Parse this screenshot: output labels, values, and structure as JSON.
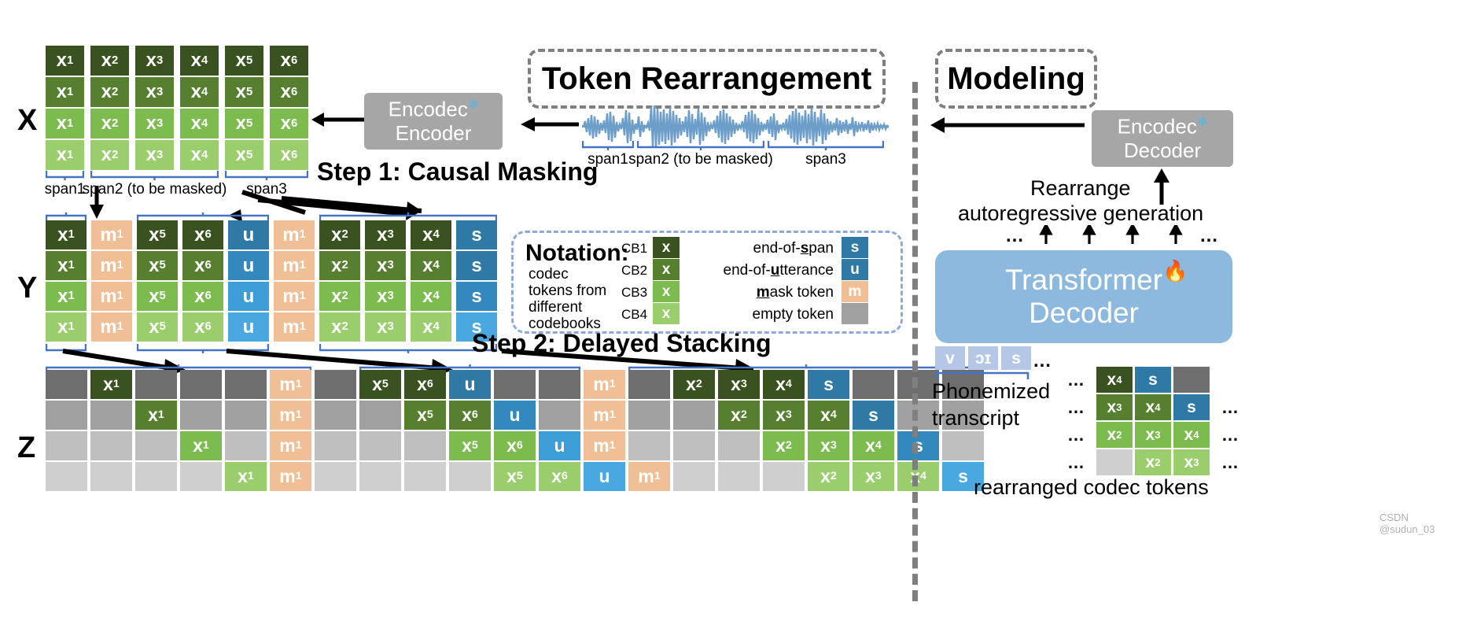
{
  "colors": {
    "cb1": "#3a5220",
    "cb2": "#56802f",
    "cb3": "#7cbb4e",
    "cb4": "#9ace6c",
    "mask": "#f0bf96",
    "eos_span": "#2e79a6",
    "eou": "#3d9dd6",
    "eos_span2": "#3389bd",
    "eou2": "#4aa8e0",
    "empty_dark": "#6e6e6e",
    "empty_mid": "#a0a0a0",
    "empty_light": "#bfbfbf",
    "bracket": "#4472c4",
    "wave": "#6d9ec9",
    "phoneme": "#b4c7e7",
    "transformer": "#8cb9dd",
    "gray_block": "#a6a6a6",
    "dash_gray": "#7f7f7f",
    "dash_blue": "#8da9db"
  },
  "headers": {
    "token_rearrangement": "Token Rearrangement",
    "modeling": "Modeling",
    "step1": "Step 1: Causal Masking",
    "step2": "Step 2: Delayed Stacking"
  },
  "row_labels": {
    "x": "X",
    "y": "Y",
    "z": "Z"
  },
  "encodec": {
    "encoder_line1": "Encodec",
    "encoder_line2": "Encoder",
    "decoder_line1": "Encodec",
    "decoder_line2": "Decoder",
    "snowflake": "❄"
  },
  "spans": {
    "span1": "span1",
    "span2": "span2 (to be masked)",
    "span3": "span3"
  },
  "matrix_x": {
    "columns": [
      "x₁",
      "x₂",
      "x₃",
      "x₄",
      "x₅",
      "x₆"
    ],
    "base": [
      "x",
      "x",
      "x",
      "x",
      "x",
      "x"
    ],
    "subs": [
      "1",
      "2",
      "3",
      "4",
      "5",
      "6"
    ],
    "rows": 4,
    "col_groups": [
      {
        "label": "span1",
        "start": 0,
        "count": 1
      },
      {
        "label": "span2 (to be masked)",
        "start": 1,
        "count": 3
      },
      {
        "label": "span3",
        "start": 4,
        "count": 2
      }
    ]
  },
  "matrix_y": {
    "cells": [
      {
        "base": "x",
        "sub": "1",
        "kind": "codec"
      },
      {
        "base": "m",
        "sub": "1",
        "kind": "mask"
      },
      {
        "base": "x",
        "sub": "5",
        "kind": "codec"
      },
      {
        "base": "x",
        "sub": "6",
        "kind": "codec"
      },
      {
        "base": "u",
        "sub": "",
        "kind": "eou"
      },
      {
        "base": "m",
        "sub": "1",
        "kind": "mask"
      },
      {
        "base": "x",
        "sub": "2",
        "kind": "codec"
      },
      {
        "base": "x",
        "sub": "3",
        "kind": "codec"
      },
      {
        "base": "x",
        "sub": "4",
        "kind": "codec"
      },
      {
        "base": "s",
        "sub": "",
        "kind": "eos"
      }
    ],
    "rows": 4,
    "brackets": [
      {
        "start": 0,
        "count": 1
      },
      {
        "start": 2,
        "count": 3
      },
      {
        "start": 6,
        "count": 4
      }
    ]
  },
  "matrix_z": {
    "rows": 4,
    "cols": 17,
    "grid": [
      [
        {
          "kind": "empty"
        },
        {
          "base": "x",
          "sub": "1",
          "kind": "codec"
        },
        {
          "kind": "empty"
        },
        {
          "kind": "empty"
        },
        {
          "kind": "empty"
        },
        {
          "base": "m",
          "sub": "1",
          "kind": "mask"
        },
        {
          "kind": "empty"
        },
        {
          "base": "x",
          "sub": "5",
          "kind": "codec"
        },
        {
          "base": "x",
          "sub": "6",
          "kind": "codec"
        },
        {
          "base": "u",
          "sub": "",
          "kind": "eou"
        },
        {
          "kind": "empty"
        },
        {
          "kind": "empty"
        },
        {
          "base": "m",
          "sub": "1",
          "kind": "mask"
        },
        {
          "kind": "empty"
        },
        {
          "base": "x",
          "sub": "2",
          "kind": "codec"
        },
        {
          "base": "x",
          "sub": "3",
          "kind": "codec"
        },
        {
          "base": "x",
          "sub": "4",
          "kind": "codec"
        },
        {
          "base": "s",
          "sub": "",
          "kind": "eos"
        },
        {
          "kind": "empty"
        },
        {
          "kind": "empty"
        },
        {
          "kind": "empty"
        }
      ],
      [
        {
          "kind": "empty"
        },
        {
          "kind": "empty"
        },
        {
          "base": "x",
          "sub": "1",
          "kind": "codec"
        },
        {
          "kind": "empty"
        },
        {
          "kind": "empty"
        },
        {
          "base": "m",
          "sub": "1",
          "kind": "mask"
        },
        {
          "kind": "empty"
        },
        {
          "kind": "empty"
        },
        {
          "base": "x",
          "sub": "5",
          "kind": "codec"
        },
        {
          "base": "x",
          "sub": "6",
          "kind": "codec"
        },
        {
          "base": "u",
          "sub": "",
          "kind": "eou"
        },
        {
          "kind": "empty"
        },
        {
          "base": "m",
          "sub": "1",
          "kind": "mask"
        },
        {
          "kind": "empty"
        },
        {
          "kind": "empty"
        },
        {
          "base": "x",
          "sub": "2",
          "kind": "codec"
        },
        {
          "base": "x",
          "sub": "3",
          "kind": "codec"
        },
        {
          "base": "x",
          "sub": "4",
          "kind": "codec"
        },
        {
          "base": "s",
          "sub": "",
          "kind": "eos"
        },
        {
          "kind": "empty"
        },
        {
          "kind": "empty"
        }
      ],
      [
        {
          "kind": "empty"
        },
        {
          "kind": "empty"
        },
        {
          "kind": "empty"
        },
        {
          "base": "x",
          "sub": "1",
          "kind": "codec"
        },
        {
          "kind": "empty"
        },
        {
          "base": "m",
          "sub": "1",
          "kind": "mask"
        },
        {
          "kind": "empty"
        },
        {
          "kind": "empty"
        },
        {
          "kind": "empty"
        },
        {
          "base": "x",
          "sub": "5",
          "kind": "codec"
        },
        {
          "base": "x",
          "sub": "6",
          "kind": "codec"
        },
        {
          "base": "u",
          "sub": "",
          "kind": "eou"
        },
        {
          "base": "m",
          "sub": "1",
          "kind": "mask"
        },
        {
          "kind": "empty"
        },
        {
          "kind": "empty"
        },
        {
          "kind": "empty"
        },
        {
          "base": "x",
          "sub": "2",
          "kind": "codec"
        },
        {
          "base": "x",
          "sub": "3",
          "kind": "codec"
        },
        {
          "base": "x",
          "sub": "4",
          "kind": "codec"
        },
        {
          "base": "s",
          "sub": "",
          "kind": "eos"
        },
        {
          "kind": "empty"
        }
      ],
      [
        {
          "kind": "empty"
        },
        {
          "kind": "empty"
        },
        {
          "kind": "empty"
        },
        {
          "kind": "empty"
        },
        {
          "base": "x",
          "sub": "1",
          "kind": "codec"
        },
        {
          "base": "m",
          "sub": "1",
          "kind": "mask"
        },
        {
          "kind": "empty"
        },
        {
          "kind": "empty"
        },
        {
          "kind": "empty"
        },
        {
          "kind": "empty"
        },
        {
          "base": "x",
          "sub": "5",
          "kind": "codec"
        },
        {
          "base": "x",
          "sub": "6",
          "kind": "codec"
        },
        {
          "base": "u",
          "sub": "",
          "kind": "eou"
        },
        {
          "base": "m",
          "sub": "1",
          "kind": "mask"
        },
        {
          "kind": "empty"
        },
        {
          "kind": "empty"
        },
        {
          "kind": "empty"
        },
        {
          "base": "x",
          "sub": "2",
          "kind": "codec"
        },
        {
          "base": "x",
          "sub": "3",
          "kind": "codec"
        },
        {
          "base": "x",
          "sub": "4",
          "kind": "codec"
        },
        {
          "base": "s",
          "sub": "",
          "kind": "eos"
        }
      ]
    ],
    "brackets": [
      {
        "start": 0,
        "count": 6
      },
      {
        "start": 7,
        "count": 5
      },
      {
        "start": 13,
        "count": 8
      }
    ]
  },
  "notation": {
    "title": "Notation:",
    "left_desc": [
      "codec",
      "tokens from",
      "different",
      "codebooks"
    ],
    "codebooks": [
      {
        "label": "CB1",
        "token": "x",
        "kind": "cb1"
      },
      {
        "label": "CB2",
        "token": "x",
        "kind": "cb2"
      },
      {
        "label": "CB3",
        "token": "x",
        "kind": "cb3"
      },
      {
        "label": "CB4",
        "token": "x",
        "kind": "cb4"
      }
    ],
    "right_items": [
      {
        "pre": "end-of-",
        "bold": "s",
        "post": "pan",
        "token": "s",
        "kind": "eos"
      },
      {
        "pre": "end-of-",
        "bold": "u",
        "post": "tterance",
        "token": "u",
        "kind": "eou"
      },
      {
        "pre": "",
        "bold": "m",
        "post": "ask token",
        "token": "m",
        "kind": "mask"
      },
      {
        "pre": "empty token",
        "bold": "",
        "post": "",
        "token": "",
        "kind": "empty"
      }
    ]
  },
  "modeling": {
    "rearrange": "Rearrange",
    "autoregressive": "autoregressive generation",
    "transformer_line1": "Transformer",
    "transformer_line2": "Decoder",
    "fire": "🔥",
    "phonemes": [
      "v",
      "ɔɪ",
      "s"
    ],
    "phonemized_line1": "Phonemized",
    "phonemized_line2": "transcript",
    "ellipsis": "…",
    "rearranged_caption": "rearranged codec tokens",
    "out_grid": [
      [
        {
          "kind": "ell"
        },
        {
          "base": "x",
          "sub": "4",
          "kind": "codec"
        },
        {
          "base": "s",
          "sub": "",
          "kind": "eos"
        },
        {
          "kind": "empty"
        },
        {
          "kind": "none"
        }
      ],
      [
        {
          "kind": "ell"
        },
        {
          "base": "x",
          "sub": "3",
          "kind": "codec"
        },
        {
          "base": "x",
          "sub": "4",
          "kind": "codec"
        },
        {
          "base": "s",
          "sub": "",
          "kind": "eos"
        },
        {
          "kind": "ell"
        }
      ],
      [
        {
          "kind": "ell"
        },
        {
          "base": "x",
          "sub": "2",
          "kind": "codec"
        },
        {
          "base": "x",
          "sub": "3",
          "kind": "codec"
        },
        {
          "base": "x",
          "sub": "4",
          "kind": "codec"
        },
        {
          "kind": "ell"
        }
      ],
      [
        {
          "kind": "ell"
        },
        {
          "kind": "empty"
        },
        {
          "base": "x",
          "sub": "2",
          "kind": "codec"
        },
        {
          "base": "x",
          "sub": "3",
          "kind": "codec"
        },
        {
          "kind": "ell"
        }
      ]
    ]
  },
  "credit": "CSDN @sudun_03"
}
